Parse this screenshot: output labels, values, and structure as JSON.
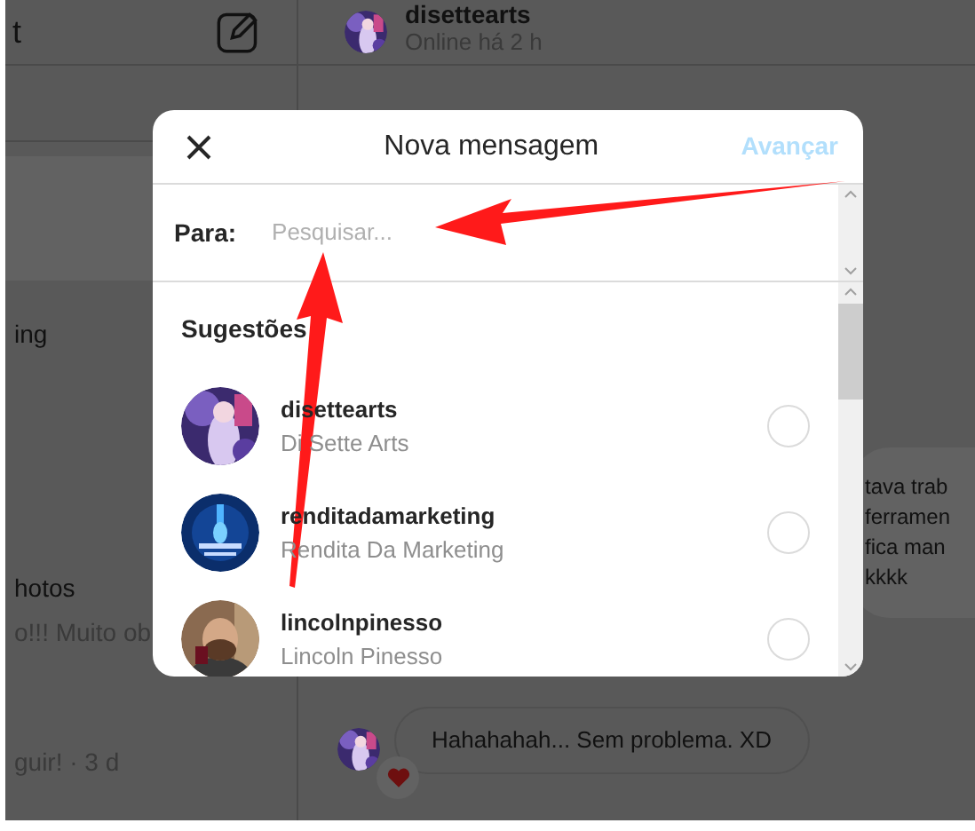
{
  "sidebar": {
    "title": "t",
    "texts": [
      {
        "kind": "plain",
        "text": "ing"
      },
      {
        "kind": "plain",
        "text": "hotos"
      },
      {
        "kind": "muted",
        "text": "o!!! Muito ob"
      },
      {
        "kind": "muted",
        "text": "guir! · 3 d"
      }
    ]
  },
  "chat": {
    "contact": "disettearts",
    "status": "Online há 2 h",
    "messages": [
      {
        "kind": "right",
        "lines": [
          "tava trab",
          "ferramen",
          "fica man",
          "kkkk"
        ]
      },
      {
        "kind": "left",
        "lines": [
          "Hahahahah... Sem problema. XD"
        ]
      }
    ]
  },
  "modal": {
    "title": "Nova mensagem",
    "action": {
      "label": "Avançar",
      "disabled": true
    },
    "to_label": "Para:",
    "search": {
      "placeholder": "Pesquisar..."
    },
    "section": "Sugestões",
    "suggestions": [
      {
        "username": "disettearts",
        "name": "Di Sette Arts",
        "selected": false
      },
      {
        "username": "renditadamarketing",
        "name": "Rendita Da Marketing",
        "selected": false
      },
      {
        "username": "lincolnpinesso",
        "name": "Lincoln Pinesso",
        "selected": false
      }
    ]
  }
}
